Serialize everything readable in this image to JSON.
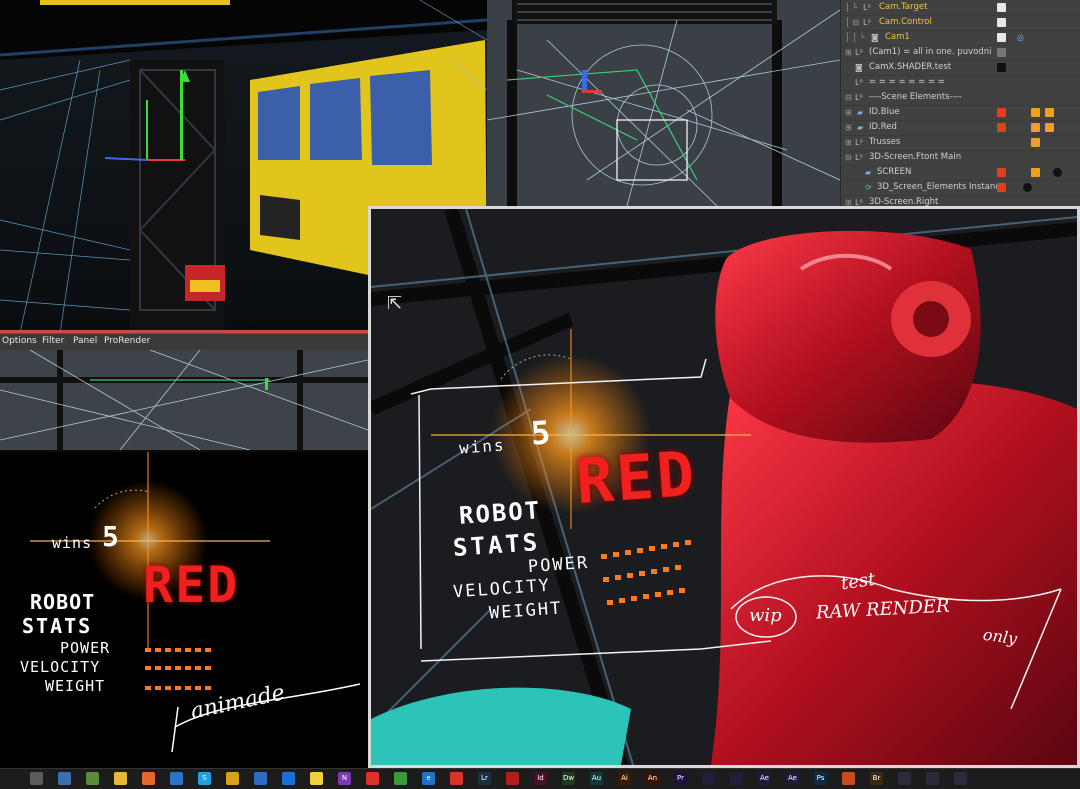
{
  "object_manager": {
    "rows": [
      {
        "label": "Cam.Target",
        "selected": true
      },
      {
        "label": "Cam.Control",
        "selected": true
      },
      {
        "label": "Cam1",
        "selected": true
      },
      {
        "label": "(Cam1) = all in one. puvodni",
        "selected": false
      },
      {
        "label": "CamX.SHADER.test",
        "selected": false
      },
      {
        "label": "= = = = = = = =",
        "selected": false
      },
      {
        "label": "----Scene Elements----",
        "selected": false
      },
      {
        "label": "ID.Blue",
        "selected": false
      },
      {
        "label": "ID.Red",
        "selected": false
      },
      {
        "label": "Trusses",
        "selected": false
      },
      {
        "label": "3D-Screen.Ftont Main",
        "selected": false
      },
      {
        "label": "SCREEN",
        "selected": false
      },
      {
        "label": "3D_Screen_Elements Instance",
        "selected": false
      },
      {
        "label": "3D-Screen.Right",
        "selected": false
      }
    ],
    "tag_colors": {
      "red": "#e0401a",
      "white": "#e8e8e8",
      "black": "#111111"
    }
  },
  "viewport_menu": {
    "items": [
      "Options",
      "Filter",
      "Panel",
      "ProRender"
    ]
  },
  "render_small": {
    "wins_label": "wins",
    "wins_count": "5",
    "team": "RED",
    "stats_title_1": "ROBOT",
    "stats_title_2": "STATS",
    "stat_1": "POWER",
    "stat_2": "VELOCITY",
    "stat_3": "WEIGHT",
    "signature": "animade"
  },
  "render_big": {
    "wins_label": "wins",
    "wins_count": "5",
    "team": "RED",
    "stats_title_1": "ROBOT",
    "stats_title_2": "STATS",
    "stat_1": "POWER",
    "stat_2": "VELOCITY",
    "stat_3": "WEIGHT",
    "annotation_1": "test",
    "annotation_2": "wip",
    "annotation_3": "RAW RENDER",
    "annotation_4": "only"
  },
  "taskbar": {
    "icons": [
      {
        "name": "calculator-icon",
        "color": "#5b5b5b",
        "text": ""
      },
      {
        "name": "save-icon",
        "color": "#3a6fb0",
        "text": ""
      },
      {
        "name": "minecraft-icon",
        "color": "#5c8a3a",
        "text": ""
      },
      {
        "name": "folder-icon",
        "color": "#e8b83a",
        "text": ""
      },
      {
        "name": "firefox-icon",
        "color": "#e8672a",
        "text": ""
      },
      {
        "name": "edge-icon",
        "color": "#2b74c9",
        "text": ""
      },
      {
        "name": "skype-icon",
        "color": "#1ea0e0",
        "text": "S"
      },
      {
        "name": "chrome-icon",
        "color": "#d9a21e",
        "text": ""
      },
      {
        "name": "mail-icon",
        "color": "#2d6bc4",
        "text": ""
      },
      {
        "name": "teamviewer-icon",
        "color": "#1c6fd6",
        "text": ""
      },
      {
        "name": "sticky-notes-icon",
        "color": "#f2d23a",
        "text": ""
      },
      {
        "name": "onenote-icon",
        "color": "#7a3bb0",
        "text": "N"
      },
      {
        "name": "maps-icon",
        "color": "#e0302a",
        "text": ""
      },
      {
        "name": "camtasia-icon",
        "color": "#3a9a3a",
        "text": ""
      },
      {
        "name": "ie-icon",
        "color": "#1c74c9",
        "text": "e"
      },
      {
        "name": "creative-cloud-icon",
        "color": "#d9342a",
        "text": ""
      },
      {
        "name": "lightroom-icon",
        "color": "#1b2f45",
        "text": "Lr"
      },
      {
        "name": "acrobat-icon",
        "color": "#b51c1c",
        "text": ""
      },
      {
        "name": "indesign-icon",
        "color": "#4a0f2a",
        "text": "Id"
      },
      {
        "name": "dreamweaver-icon",
        "color": "#1f3a1f",
        "text": "Dw"
      },
      {
        "name": "audition-icon",
        "color": "#0f3a3a",
        "text": "Au"
      },
      {
        "name": "illustrator-icon",
        "color": "#3a1c00",
        "text": "Ai"
      },
      {
        "name": "animate-icon",
        "color": "#3a1300",
        "text": "An"
      },
      {
        "name": "premiere-icon",
        "color": "#1f0f3a",
        "text": "Pr"
      },
      {
        "name": "media-encoder-icon",
        "color": "#1f1f3a",
        "text": ""
      },
      {
        "name": "media-encoder-2-icon",
        "color": "#1f1f3a",
        "text": ""
      },
      {
        "name": "after-effects-icon",
        "color": "#1f1a3a",
        "text": "Ae"
      },
      {
        "name": "after-effects-2-icon",
        "color": "#1f1a3a",
        "text": "Ae"
      },
      {
        "name": "photoshop-icon",
        "color": "#0f2a45",
        "text": "Ps"
      },
      {
        "name": "lobster-icon",
        "color": "#c94a1e",
        "text": ""
      },
      {
        "name": "bridge-icon",
        "color": "#3a2a0f",
        "text": "Br"
      },
      {
        "name": "cinema4d-icon",
        "color": "#2a2a3a",
        "text": ""
      },
      {
        "name": "cinema4d-2-icon",
        "color": "#2a2a3a",
        "text": ""
      },
      {
        "name": "cinema4d-3-icon",
        "color": "#2a2a3a",
        "text": ""
      }
    ]
  }
}
